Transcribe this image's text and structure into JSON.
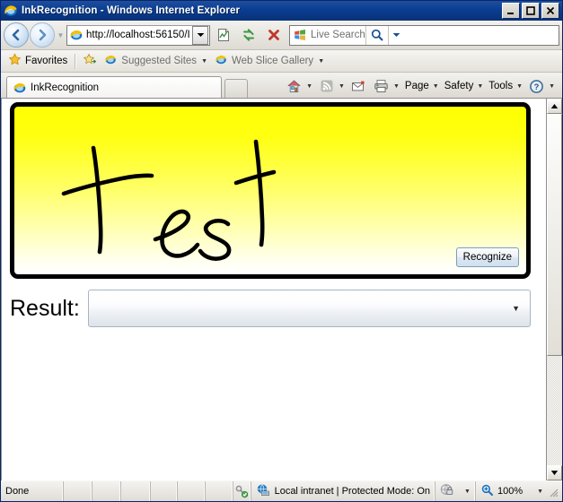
{
  "window": {
    "title": "InkRecognition - Windows Internet Explorer",
    "icon": "internet-explorer-icon",
    "minimize_label": "Minimize",
    "maximize_label": "Maximize",
    "close_label": "Close"
  },
  "navbar": {
    "back_label": "Back",
    "forward_label": "Forward",
    "recent_pages_label": "Recent Pages",
    "address": {
      "url": "http://localhost:56150/I",
      "favicon": "page-icon",
      "dropdown_label": "Address dropdown"
    },
    "compatibility_label": "Compatibility View",
    "refresh_label": "Refresh",
    "stop_label": "Stop",
    "search": {
      "placeholder": "Live Search",
      "provider_icon": "windows-logo-icon",
      "go_label": "Search",
      "dropdown_label": "Search options"
    }
  },
  "favorites_bar": {
    "favorites_label": "Favorites",
    "add_label": "Add to Favorites Bar",
    "items": [
      {
        "label": "Suggested Sites",
        "icon": "ie-page-icon",
        "has_caret": true
      },
      {
        "label": "Web Slice Gallery",
        "icon": "ie-page-icon",
        "has_caret": true
      }
    ]
  },
  "tabs": {
    "items": [
      {
        "label": "InkRecognition",
        "icon": "internet-explorer-icon",
        "active": true
      }
    ],
    "new_tab_label": "New Tab"
  },
  "command_bar": {
    "items": [
      {
        "name": "home",
        "label": "",
        "icon": "home-icon",
        "has_caret": true
      },
      {
        "name": "feeds",
        "label": "",
        "icon": "rss-icon",
        "has_caret": true
      },
      {
        "name": "read-mail",
        "label": "",
        "icon": "mail-icon",
        "has_caret": false
      },
      {
        "name": "print",
        "label": "",
        "icon": "printer-icon",
        "has_caret": true
      },
      {
        "name": "page",
        "label": "Page",
        "icon": "",
        "has_caret": true
      },
      {
        "name": "safety",
        "label": "Safety",
        "icon": "",
        "has_caret": true
      },
      {
        "name": "tools",
        "label": "Tools",
        "icon": "",
        "has_caret": true
      },
      {
        "name": "help",
        "label": "",
        "icon": "help-icon",
        "has_caret": true
      }
    ]
  },
  "page": {
    "ink_canvas": {
      "name": "ink-canvas",
      "handwritten_text": "test",
      "gradient_top_color": "#ffff00",
      "gradient_bottom_color": "#ffffff",
      "border_color": "#000000",
      "stroke_color": "#000000"
    },
    "recognize_button": {
      "label": "Recognize"
    },
    "result": {
      "label": "Result:",
      "selected_value": "",
      "options": []
    }
  },
  "scrollbar": {
    "up_label": "Scroll up",
    "down_label": "Scroll down",
    "thumb_label": "Scroll thumb"
  },
  "status_bar": {
    "status": "Done",
    "zone": "Local intranet | Protected Mode: On",
    "zone_icon": "internet-zone-icon",
    "security_icon": "certificate-key-icon",
    "privacy_icon": "privacy-report-icon",
    "zoom_icon": "zoom-magnifier-icon",
    "zoom_level": "100%",
    "resize_grip_label": "Resize"
  }
}
